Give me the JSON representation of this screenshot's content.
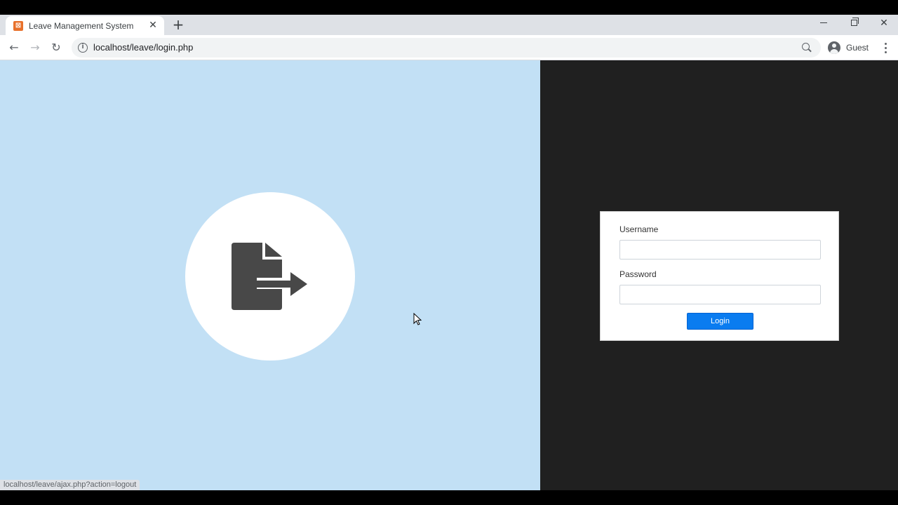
{
  "browser": {
    "tab": {
      "title": "Leave Management System",
      "favicon": "xampp-favicon-icon",
      "favicon_glyph": "⊠",
      "close": "✕"
    },
    "new_tab": "+",
    "window": {
      "minimize": "minimize-icon",
      "maximize": "restore-icon",
      "close": "✕"
    },
    "nav": {
      "back": "←",
      "forward": "→",
      "reload": "↻"
    },
    "address": {
      "url": "localhost/leave/login.php",
      "info_icon": "i"
    },
    "profile": {
      "label": "Guest"
    }
  },
  "page": {
    "left_bg": "#c2e0f5",
    "right_bg": "#202020",
    "logo": "file-export-icon",
    "login": {
      "username_label": "Username",
      "username_value": "",
      "password_label": "Password",
      "password_value": "",
      "button_label": "Login",
      "button_color": "#0a7cf0"
    }
  },
  "status_bar": {
    "link": "localhost/leave/ajax.php?action=logout"
  }
}
